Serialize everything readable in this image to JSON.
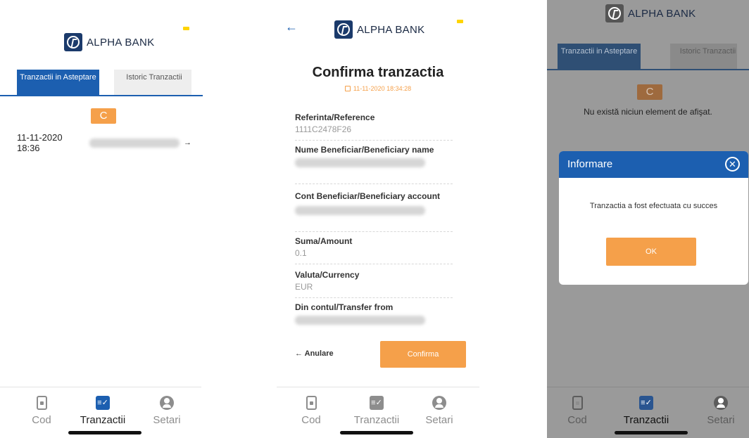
{
  "brand": {
    "name": "ALPHA BANK"
  },
  "tabs": {
    "pending": "Tranzactii in Asteptare",
    "history": "Istoric Tranzactii"
  },
  "nav": {
    "cod": "Cod",
    "tranzactii": "Tranzactii",
    "setari": "Setari"
  },
  "screen1": {
    "refresh_icon": "C",
    "transaction": {
      "datetime": "11-11-2020 18:36",
      "arrow": "→"
    }
  },
  "screen2": {
    "back_icon": "←",
    "title": "Confirma tranzactia",
    "datetime": "11-11-2020 18:34:28",
    "fields": [
      {
        "label": "Referinta/Reference",
        "value": "1111C2478F26"
      },
      {
        "label": "Nume Beneficiar/Beneficiary name",
        "value": ""
      },
      {
        "label": "Cont Beneficiar/Beneficiary account",
        "value": ""
      },
      {
        "label": "Suma/Amount",
        "value": "0.1"
      },
      {
        "label": "Valuta/Currency",
        "value": "EUR"
      },
      {
        "label": "Din contul/Transfer from",
        "value": ""
      }
    ],
    "cancel": "← Anulare",
    "confirm": "Confirma"
  },
  "screen3": {
    "refresh_icon": "C",
    "empty_message": "Nu există niciun element de afişat.",
    "modal": {
      "title": "Informare",
      "close_icon": "✕",
      "message": "Tranzactia a fost efectuata cu succes",
      "ok": "OK"
    }
  },
  "colors": {
    "primary": "#1c5fb0",
    "accent": "#f5a04a",
    "brand_navy": "#1b3a6b",
    "overlay": "#9a9a9a"
  }
}
